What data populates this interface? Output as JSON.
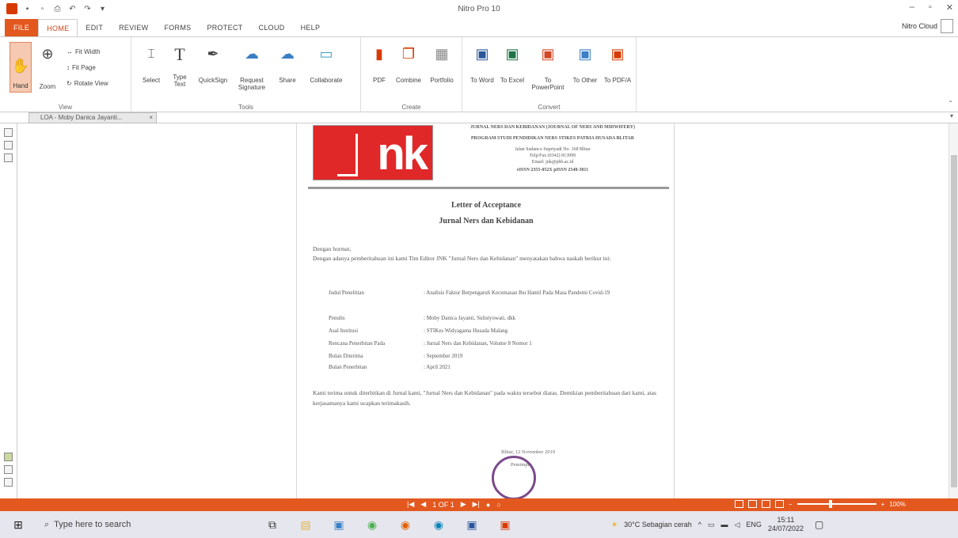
{
  "window": {
    "title": "Nitro Pro 10"
  },
  "ribbon_tabs": [
    "FILE",
    "HOME",
    "EDIT",
    "REVIEW",
    "FORMS",
    "PROTECT",
    "CLOUD",
    "HELP"
  ],
  "user": {
    "name": "Nitro Cloud"
  },
  "groups": {
    "view": {
      "label": "View",
      "hand": "Hand",
      "zoom": "Zoom",
      "fit_width": "Fit Width",
      "fit_page": "Fit Page",
      "rotate": "Rotate View"
    },
    "tools": {
      "label": "Tools",
      "select": "Select",
      "type_text": "Type Text",
      "quicksign": "QuickSign",
      "request_signature": "Request Signature",
      "share": "Share",
      "collaborate": "Collaborate"
    },
    "create": {
      "label": "Create",
      "pdf": "PDF",
      "combine": "Combine",
      "portfolio": "Portfolio"
    },
    "convert": {
      "label": "Convert",
      "to_word": "To Word",
      "to_excel": "To Excel",
      "to_powerpoint": "To PowerPoint",
      "to_other": "To Other",
      "to_pdfa": "To PDF/A"
    }
  },
  "doc_tab": {
    "label": "LOA - Moby Danica Jayanti..."
  },
  "document": {
    "header_lines": [
      "JURNAL NERS DAN KEBIDANAN (JOURNAL OF NERS AND MIDWIFERY)",
      "PROGRAM STUDI PENDIDIKAN NERS STIKES PATRIA HUSADA BLITAR",
      "Jalan Sudanco Supriyadi No. 168 Blitar",
      "Telp/Fax (0342) 813999",
      "Email: jnk@phb.ac.id",
      "eISSN 2355-052X  pISSN 2548-3811"
    ],
    "title1": "Letter of Acceptance",
    "title2": "Jurnal Ners dan Kebidanan",
    "greeting": "Dengan hormat,",
    "intro": "Dengan adanya pemberitahuan ini kami Tim Editor JNK \"Jurnal Ners dan Kebidanan\" menyatakan bahwa naskah berikut ini:",
    "details": [
      {
        "k": "Judul Penelitian",
        "v": ": Analisis Faktor Berpengaruh Kecemasan Ibu Hamil Pada Masa Pandemi Covid-19"
      },
      {
        "k": "Penulis",
        "v": ": Moby Danica Jayanti, Sulistyowati, dkk"
      },
      {
        "k": "Asal Institusi",
        "v": ": STIKes Widyagama Husada Malang"
      },
      {
        "k": "Rencana Penerbitan Pada",
        "v": ": Jurnal Ners dan Kebidanan, Volume 8 Nomor 1"
      },
      {
        "k": "Bulan Diterima",
        "v": ": September 2019"
      },
      {
        "k": "Bulan Penerbitan",
        "v": ": April 2021"
      }
    ],
    "closing": "Kami terima untuk diterbitkan di Jurnal kami, \"Jurnal Ners dan Kebidanan\" pada waktu tersebut diatas. Demikian pemberitahuan dari kami, atas kerjasamanya kami ucapkan terimakasih.",
    "sign_place": "Blitar, 12 November 2019",
    "sign_role": "Pemimpin"
  },
  "statusbar": {
    "page": "1 OF 1",
    "zoom": "100%"
  },
  "taskbar": {
    "search_placeholder": "Type here to search",
    "weather": "30°C Sebagian cerah",
    "lang": "ENG",
    "time": "15:11",
    "date": "24/07/2022"
  }
}
